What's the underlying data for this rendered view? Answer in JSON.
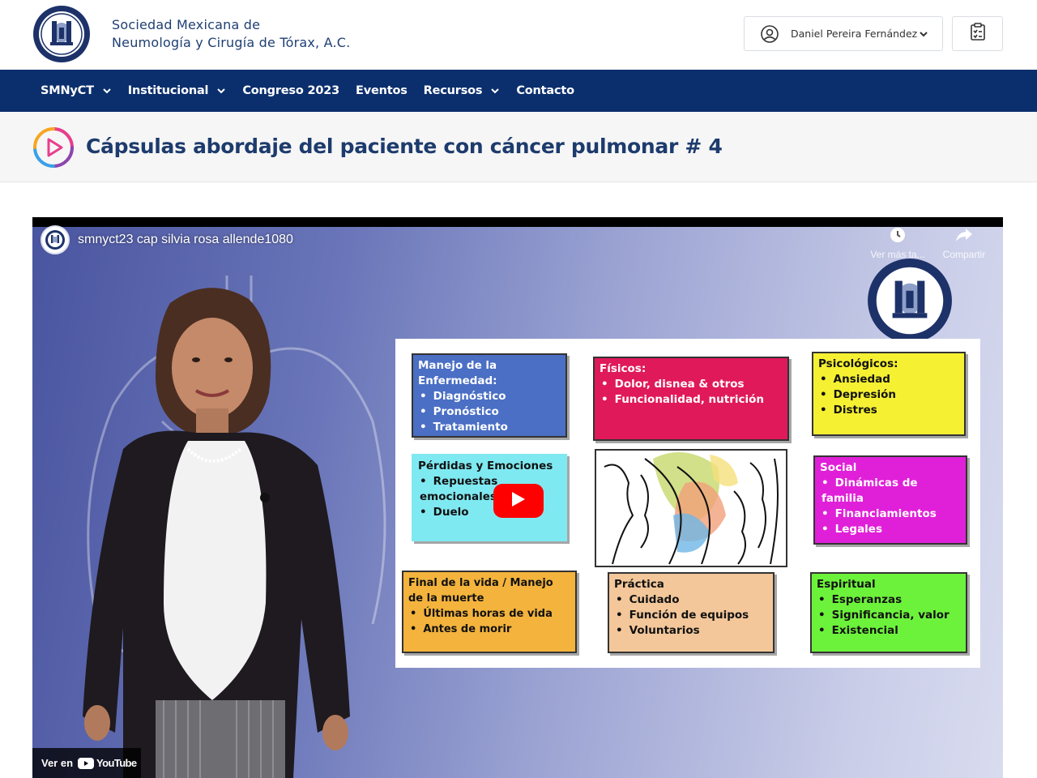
{
  "header": {
    "org_name_line1": "Sociedad Mexicana de",
    "org_name_line2": "Neumología y Cirugía de Tórax, A.C.",
    "user_name": "Daniel Pereira Fernández"
  },
  "nav": {
    "items": [
      {
        "label": "SMNyCT",
        "has_dropdown": true
      },
      {
        "label": "Institucional",
        "has_dropdown": true
      },
      {
        "label": "Congreso 2023",
        "has_dropdown": false
      },
      {
        "label": "Eventos",
        "has_dropdown": false
      },
      {
        "label": "Recursos",
        "has_dropdown": true
      },
      {
        "label": "Contacto",
        "has_dropdown": false
      }
    ]
  },
  "page": {
    "title": "Cápsulas abordaje del paciente con cáncer pulmonar # 4"
  },
  "video": {
    "title": "smnyct23 cap silvia rosa allende1080",
    "watch_later_label": "Ver más ta...",
    "share_label": "Compartir",
    "watch_on_label": "Ver en",
    "youtube_label": "YouTube",
    "slide": {
      "boxes": [
        {
          "heading": "Manejo de la Enfermedad:",
          "items": [
            "Diagnóstico",
            "Pronóstico",
            "Tratamiento"
          ],
          "color": "#4a6fc4"
        },
        {
          "heading": "Físicos:",
          "items": [
            "Dolor, disnea & otros",
            "Funcionalidad, nutrición"
          ],
          "color": "#e0195a"
        },
        {
          "heading": "Psicológicos:",
          "items": [
            "Ansiedad",
            "Depresión",
            "Distres"
          ],
          "color": "#f5f032"
        },
        {
          "heading": "Pérdidas y Emociones",
          "items": [
            "Repuestas emocionales",
            "Duelo"
          ],
          "color": "#7fe9f1"
        },
        {
          "heading": "Social",
          "items": [
            "Dinámicas de familia",
            "Financiamientos",
            "Legales"
          ],
          "color": "#e020d8"
        },
        {
          "heading": "Final de la vida / Manejo de la muerte",
          "items": [
            "Últimas horas de vida",
            "Antes de morir"
          ],
          "color": "#f3b33c"
        },
        {
          "heading": "Práctica",
          "items": [
            "Cuidado",
            "Función de equipos",
            "Voluntarios"
          ],
          "color": "#f3c79a"
        },
        {
          "heading": "Espiritual",
          "items": [
            "Esperanzas",
            "Significancia, valor",
            "Existencial"
          ],
          "color": "#6df23c"
        }
      ]
    }
  },
  "colors": {
    "nav_bg": "#0b2f6d",
    "title_text": "#1d3b6d",
    "youtube_red": "#ff0000"
  }
}
